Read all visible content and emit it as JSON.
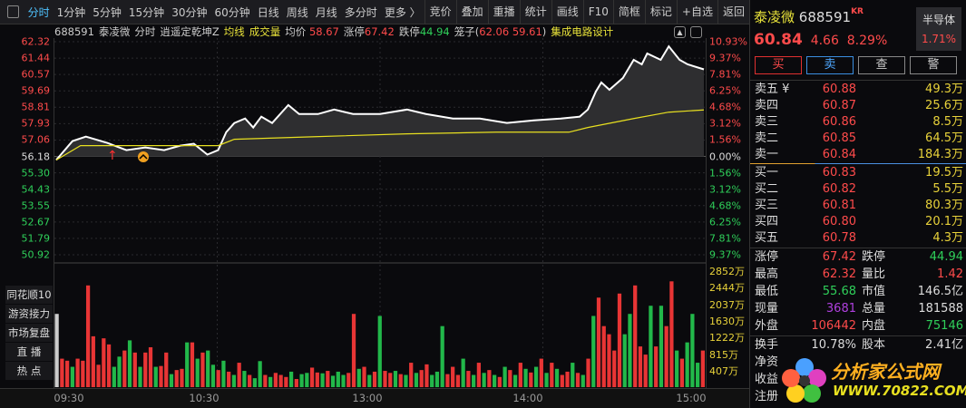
{
  "toolbar": {
    "tabs": [
      "分时",
      "1分钟",
      "5分钟",
      "15分钟",
      "30分钟",
      "60分钟",
      "日线",
      "周线",
      "月线",
      "多分时",
      "更多 〉"
    ],
    "buttons": [
      "竞价",
      "叠加",
      "重播",
      "统计",
      "画线",
      "F10",
      "简框",
      "标记",
      "+自选",
      "返回"
    ]
  },
  "info": {
    "code": "688591",
    "name": "泰凌微",
    "mode": "分时",
    "indicator": "逍遥定乾坤Z",
    "avg_label": "均线",
    "vol_label": "成交量",
    "avgprice_label": "均价",
    "avgprice": "58.67",
    "limitup_label": "涨停",
    "limitup": "67.42",
    "limitdown_label": "跌停",
    "limitdown": "44.94",
    "cage_label": "笼子(",
    "cage_a": "62.06",
    "cage_b": "59.61",
    ")": ")",
    "sector": "集成电路设计"
  },
  "price_axis": [
    "62.32",
    "61.44",
    "60.57",
    "59.69",
    "58.81",
    "57.93",
    "57.06",
    "56.18",
    "55.30",
    "54.43",
    "53.55",
    "52.67",
    "51.79",
    "50.92"
  ],
  "pct_axis": [
    "10.93%",
    "9.37%",
    "7.81%",
    "6.25%",
    "4.68%",
    "3.12%",
    "1.56%",
    "0.00%",
    "1.56%",
    "3.12%",
    "4.68%",
    "6.25%",
    "7.81%",
    "9.37%"
  ],
  "vol_axis": [
    "2852万",
    "2444万",
    "2037万",
    "1630万",
    "1222万",
    "815万",
    "407万"
  ],
  "side_buttons": [
    "同花顺10",
    "游资接力",
    "市场复盘",
    "直  播",
    "热  点"
  ],
  "time_axis": [
    "09:30",
    "10:30",
    "13:00",
    "14:00",
    "15:00"
  ],
  "chart_data": {
    "type": "line",
    "prev_close": 56.18,
    "price_range": [
      50.92,
      62.32
    ],
    "vol_max": 2852,
    "price": [
      [
        0,
        55.99
      ],
      [
        6,
        57.0
      ],
      [
        11,
        57.24
      ],
      [
        19,
        56.9
      ],
      [
        26,
        56.52
      ],
      [
        33,
        56.66
      ],
      [
        40,
        56.52
      ],
      [
        46,
        56.76
      ],
      [
        51,
        56.86
      ],
      [
        56,
        56.28
      ],
      [
        60,
        56.52
      ],
      [
        63,
        57.48
      ],
      [
        66,
        57.97
      ],
      [
        70,
        58.21
      ],
      [
        73,
        57.73
      ],
      [
        76,
        58.31
      ],
      [
        80,
        57.97
      ],
      [
        86,
        58.93
      ],
      [
        90,
        58.45
      ],
      [
        97,
        58.45
      ],
      [
        103,
        58.69
      ],
      [
        110,
        58.45
      ],
      [
        120,
        58.45
      ],
      [
        130,
        58.69
      ],
      [
        137,
        58.45
      ],
      [
        147,
        58.21
      ],
      [
        157,
        58.21
      ],
      [
        167,
        57.97
      ],
      [
        177,
        58.11
      ],
      [
        187,
        58.21
      ],
      [
        194,
        58.31
      ],
      [
        197,
        58.69
      ],
      [
        200,
        59.66
      ],
      [
        202,
        60.14
      ],
      [
        205,
        59.75
      ],
      [
        210,
        60.38
      ],
      [
        214,
        61.35
      ],
      [
        217,
        61.11
      ],
      [
        219,
        61.69
      ],
      [
        224,
        61.35
      ],
      [
        227,
        62.07
      ],
      [
        231,
        61.35
      ],
      [
        234,
        61.11
      ],
      [
        240,
        60.84
      ]
    ],
    "avg": [
      [
        0,
        55.99
      ],
      [
        9,
        56.76
      ],
      [
        60,
        56.76
      ],
      [
        66,
        57.1
      ],
      [
        96,
        57.24
      ],
      [
        130,
        57.39
      ],
      [
        163,
        57.48
      ],
      [
        190,
        57.48
      ],
      [
        197,
        57.73
      ],
      [
        214,
        58.21
      ],
      [
        227,
        58.55
      ],
      [
        240,
        58.67
      ]
    ],
    "volume": [
      1800,
      700,
      650,
      500,
      700,
      650,
      2500,
      1250,
      550,
      1200,
      1050,
      500,
      750,
      900,
      1150,
      850,
      500,
      850,
      980,
      500,
      520,
      850,
      320,
      420,
      450,
      1100,
      1100,
      700,
      850,
      900,
      550,
      420,
      650,
      380,
      300,
      600,
      400,
      300,
      220,
      640,
      300,
      250,
      350,
      300,
      250,
      380,
      200,
      320,
      350,
      480,
      360,
      340,
      400,
      280,
      380,
      300,
      350,
      1800,
      450,
      500,
      300,
      380,
      1750,
      400,
      350,
      400,
      320,
      300,
      600,
      350,
      420,
      560,
      300,
      380,
      1500,
      320,
      500,
      300,
      700,
      400,
      300,
      600,
      350,
      420,
      300,
      250,
      500,
      420,
      300,
      600,
      450,
      360,
      500,
      700,
      350,
      600,
      450,
      300,
      380,
      600,
      350,
      300,
      700,
      1750,
      2200,
      1500,
      1300,
      900,
      2300,
      1300,
      1800,
      2500,
      1000,
      800,
      2000,
      1000,
      2000,
      1500,
      2600,
      900,
      700,
      1100,
      1800,
      600,
      900
    ],
    "vol_colors": "wrrgrrrrrrrggrgrgrrgrrgrrgrgrggrgrgrgrggrgrrrgrggrrgrgggrrgrgrgrrgrgrgrrgggrrrgrgrgrgrgrgrgrgrgrgrrgrgrgrrrrrggrrrgrgrrgrgggrg"
  },
  "panel": {
    "name": "泰凌微",
    "code": "688591",
    "badge": "KR",
    "price": "60.84",
    "change": "4.66",
    "pct": "8.29%",
    "sector": "半导体",
    "sector_pct": "1.71%",
    "buttons": [
      "买",
      "卖",
      "查",
      "警"
    ],
    "asks": [
      {
        "l": "卖五 ¥",
        "p": "60.88",
        "v": "49.3万"
      },
      {
        "l": "卖四",
        "p": "60.87",
        "v": "25.6万"
      },
      {
        "l": "卖三",
        "p": "60.86",
        "v": "8.5万"
      },
      {
        "l": "卖二",
        "p": "60.85",
        "v": "64.5万"
      },
      {
        "l": "卖一",
        "p": "60.84",
        "v": "184.3万"
      }
    ],
    "bids": [
      {
        "l": "买一",
        "p": "60.83",
        "v": "19.5万"
      },
      {
        "l": "买二",
        "p": "60.82",
        "v": "5.5万"
      },
      {
        "l": "买三",
        "p": "60.81",
        "v": "80.3万"
      },
      {
        "l": "买四",
        "p": "60.80",
        "v": "20.1万"
      },
      {
        "l": "买五",
        "p": "60.78",
        "v": "4.3万"
      }
    ],
    "stats": [
      [
        "涨停",
        "67.42",
        "跌停",
        "44.94"
      ],
      [
        "最高",
        "62.32",
        "量比",
        "1.42"
      ],
      [
        "最低",
        "55.68",
        "市值",
        "146.5亿"
      ],
      [
        "现量",
        "3681",
        "总量",
        "181588"
      ],
      [
        "外盘",
        "106442",
        "内盘",
        "75146"
      ]
    ],
    "stats2": [
      [
        "换手",
        "10.78%",
        "股本",
        "2.41亿"
      ],
      [
        "净资",
        "",
        "",
        " "
      ],
      [
        "收益",
        "",
        "",
        ""
      ],
      [
        "注册",
        "",
        "",
        ""
      ]
    ]
  },
  "logo": {
    "text": "分析家公式网",
    "url": "WWW.70822.COM"
  }
}
